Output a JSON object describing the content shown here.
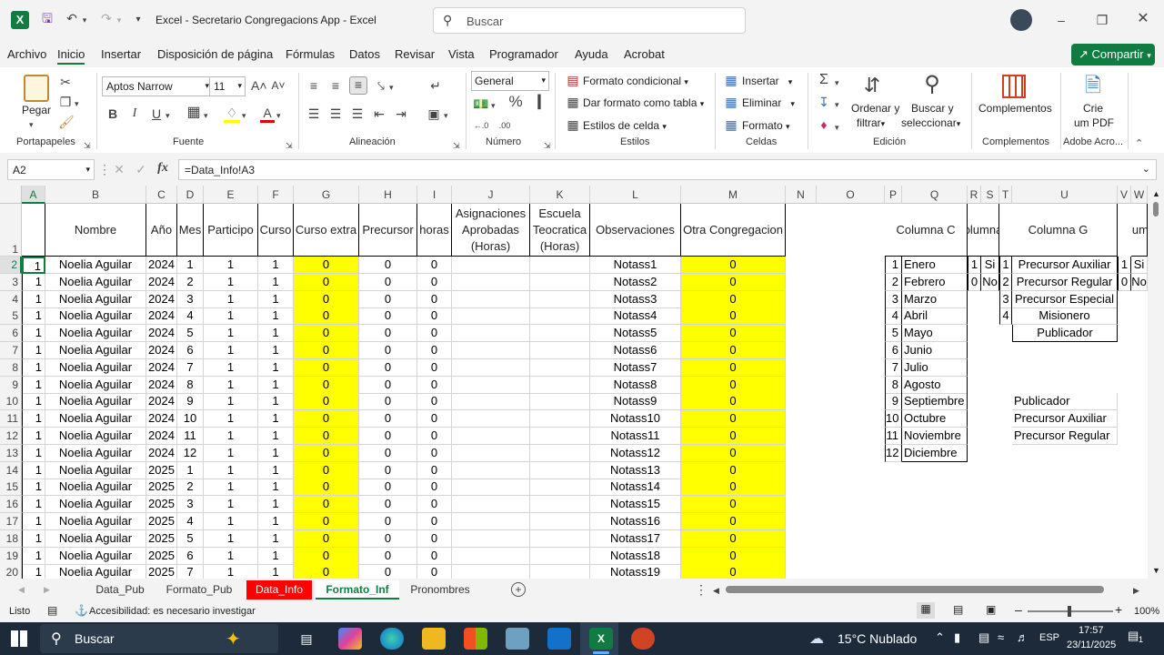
{
  "titlebar": {
    "file_title": "Excel - Secretario Congregacions App  -  Excel",
    "search_placeholder": "Buscar"
  },
  "menu": {
    "items": [
      "Archivo",
      "Inicio",
      "Insertar",
      "Disposición de página",
      "Fórmulas",
      "Datos",
      "Revisar",
      "Vista",
      "Programador",
      "Ayuda",
      "Acrobat"
    ],
    "share": "Compartir"
  },
  "ribbon": {
    "paste": "Pegar",
    "font_name": "Aptos Narrow",
    "font_size": "11",
    "number_format": "General",
    "cond_format": "Formato condicional",
    "table_format": "Dar formato como tabla",
    "cell_styles": "Estilos de celda",
    "insert": "Insertar",
    "delete": "Eliminar",
    "format": "Formato",
    "sort_filter_1": "Ordenar y",
    "sort_filter_2": "filtrar",
    "find_1": "Buscar y",
    "find_2": "seleccionar",
    "complements": "Complementos",
    "pdf_1": "Crie",
    "pdf_2": "um PDF",
    "groups": [
      "Portapapeles",
      "Fuente",
      "Alineación",
      "Número",
      "Estilos",
      "Celdas",
      "Edición",
      "Complementos",
      "Adobe Acro..."
    ]
  },
  "formula_bar": {
    "name_box": "A2",
    "formula": "=Data_Info!A3"
  },
  "columns": [
    "A",
    "B",
    "C",
    "D",
    "E",
    "F",
    "G",
    "H",
    "I",
    "J",
    "K",
    "L",
    "M",
    "N",
    "O",
    "P",
    "Q",
    "R",
    "S",
    "T",
    "U",
    "V",
    "W"
  ],
  "headers": {
    "B": "Nombre",
    "C": "Año",
    "D": "Mes",
    "E": "Participo",
    "F": "Curso",
    "G": "Curso extra",
    "H": "Precursor",
    "I": "horas",
    "J": "Asignaciones Aprobadas (Horas)",
    "K": "Escuela Teocratica (Horas)",
    "L": "Observaciones",
    "M": "Otra Congregacion",
    "Q": "Columna C",
    "R": "olumna",
    "U": "Columna G",
    "W": "olumn"
  },
  "rows": [
    {
      "n": "2",
      "a": "1",
      "name": "Noelia Aguilar",
      "year": "2024",
      "mes": "1",
      "part": "1",
      "curso": "1",
      "extra": "0",
      "prec": "0",
      "horas": "0",
      "obs": "Notass1",
      "otra": "0"
    },
    {
      "n": "3",
      "a": "1",
      "name": "Noelia Aguilar",
      "year": "2024",
      "mes": "2",
      "part": "1",
      "curso": "1",
      "extra": "0",
      "prec": "0",
      "horas": "0",
      "obs": "Notass2",
      "otra": "0"
    },
    {
      "n": "4",
      "a": "1",
      "name": "Noelia Aguilar",
      "year": "2024",
      "mes": "3",
      "part": "1",
      "curso": "1",
      "extra": "0",
      "prec": "0",
      "horas": "0",
      "obs": "Notass3",
      "otra": "0"
    },
    {
      "n": "5",
      "a": "1",
      "name": "Noelia Aguilar",
      "year": "2024",
      "mes": "4",
      "part": "1",
      "curso": "1",
      "extra": "0",
      "prec": "0",
      "horas": "0",
      "obs": "Notass4",
      "otra": "0"
    },
    {
      "n": "6",
      "a": "1",
      "name": "Noelia Aguilar",
      "year": "2024",
      "mes": "5",
      "part": "1",
      "curso": "1",
      "extra": "0",
      "prec": "0",
      "horas": "0",
      "obs": "Notass5",
      "otra": "0"
    },
    {
      "n": "7",
      "a": "1",
      "name": "Noelia Aguilar",
      "year": "2024",
      "mes": "6",
      "part": "1",
      "curso": "1",
      "extra": "0",
      "prec": "0",
      "horas": "0",
      "obs": "Notass6",
      "otra": "0"
    },
    {
      "n": "8",
      "a": "1",
      "name": "Noelia Aguilar",
      "year": "2024",
      "mes": "7",
      "part": "1",
      "curso": "1",
      "extra": "0",
      "prec": "0",
      "horas": "0",
      "obs": "Notass7",
      "otra": "0"
    },
    {
      "n": "9",
      "a": "1",
      "name": "Noelia Aguilar",
      "year": "2024",
      "mes": "8",
      "part": "1",
      "curso": "1",
      "extra": "0",
      "prec": "0",
      "horas": "0",
      "obs": "Notass8",
      "otra": "0"
    },
    {
      "n": "10",
      "a": "1",
      "name": "Noelia Aguilar",
      "year": "2024",
      "mes": "9",
      "part": "1",
      "curso": "1",
      "extra": "0",
      "prec": "0",
      "horas": "0",
      "obs": "Notass9",
      "otra": "0"
    },
    {
      "n": "11",
      "a": "1",
      "name": "Noelia Aguilar",
      "year": "2024",
      "mes": "10",
      "part": "1",
      "curso": "1",
      "extra": "0",
      "prec": "0",
      "horas": "0",
      "obs": "Notass10",
      "otra": "0"
    },
    {
      "n": "12",
      "a": "1",
      "name": "Noelia Aguilar",
      "year": "2024",
      "mes": "11",
      "part": "1",
      "curso": "1",
      "extra": "0",
      "prec": "0",
      "horas": "0",
      "obs": "Notass11",
      "otra": "0"
    },
    {
      "n": "13",
      "a": "1",
      "name": "Noelia Aguilar",
      "year": "2024",
      "mes": "12",
      "part": "1",
      "curso": "1",
      "extra": "0",
      "prec": "0",
      "horas": "0",
      "obs": "Notass12",
      "otra": "0"
    },
    {
      "n": "14",
      "a": "1",
      "name": "Noelia Aguilar",
      "year": "2025",
      "mes": "1",
      "part": "1",
      "curso": "1",
      "extra": "0",
      "prec": "0",
      "horas": "0",
      "obs": "Notass13",
      "otra": "0"
    },
    {
      "n": "15",
      "a": "1",
      "name": "Noelia Aguilar",
      "year": "2025",
      "mes": "2",
      "part": "1",
      "curso": "1",
      "extra": "0",
      "prec": "0",
      "horas": "0",
      "obs": "Notass14",
      "otra": "0"
    },
    {
      "n": "16",
      "a": "1",
      "name": "Noelia Aguilar",
      "year": "2025",
      "mes": "3",
      "part": "1",
      "curso": "1",
      "extra": "0",
      "prec": "0",
      "horas": "0",
      "obs": "Notass15",
      "otra": "0"
    },
    {
      "n": "17",
      "a": "1",
      "name": "Noelia Aguilar",
      "year": "2025",
      "mes": "4",
      "part": "1",
      "curso": "1",
      "extra": "0",
      "prec": "0",
      "horas": "0",
      "obs": "Notass16",
      "otra": "0"
    },
    {
      "n": "18",
      "a": "1",
      "name": "Noelia Aguilar",
      "year": "2025",
      "mes": "5",
      "part": "1",
      "curso": "1",
      "extra": "0",
      "prec": "0",
      "horas": "0",
      "obs": "Notass17",
      "otra": "0"
    },
    {
      "n": "19",
      "a": "1",
      "name": "Noelia Aguilar",
      "year": "2025",
      "mes": "6",
      "part": "1",
      "curso": "1",
      "extra": "0",
      "prec": "0",
      "horas": "0",
      "obs": "Notass18",
      "otra": "0"
    },
    {
      "n": "20",
      "a": "1",
      "name": "Noelia Aguilar",
      "year": "2025",
      "mes": "7",
      "part": "1",
      "curso": "1",
      "extra": "0",
      "prec": "0",
      "horas": "0",
      "obs": "Notass19",
      "otra": "0"
    }
  ],
  "months": [
    [
      "1",
      "Enero"
    ],
    [
      "2",
      "Febrero"
    ],
    [
      "3",
      "Marzo"
    ],
    [
      "4",
      "Abril"
    ],
    [
      "5",
      "Mayo"
    ],
    [
      "6",
      "Junio"
    ],
    [
      "7",
      "Julio"
    ],
    [
      "8",
      "Agosto"
    ],
    [
      "9",
      "Septiembre"
    ],
    [
      "10",
      "Octubre"
    ],
    [
      "11",
      "Noviembre"
    ],
    [
      "12",
      "Diciembre"
    ]
  ],
  "yesno": [
    [
      "1",
      "Si"
    ],
    [
      "0",
      "No"
    ]
  ],
  "precursor_types": [
    [
      "1",
      "Precursor Auxiliar"
    ],
    [
      "2",
      "Precursor Regular"
    ],
    [
      "3",
      "Precursor Especial"
    ],
    [
      "4",
      "Misionero"
    ],
    [
      "",
      "Publicador"
    ]
  ],
  "yesno_w": [
    [
      "1",
      "Si"
    ],
    [
      "0",
      "No"
    ]
  ],
  "u_list": [
    "Publicador",
    "Precursor Auxiliar",
    "Precursor Regular"
  ],
  "sheet_tabs": [
    "Data_Pub",
    "Formato_Pub",
    "Data_Info",
    "Formato_Inf",
    "Pronombres"
  ],
  "status": {
    "ready": "Listo",
    "accessibility": "Accesibilidad: es necesario investigar",
    "zoom": "100%"
  },
  "taskbar": {
    "search": "Buscar",
    "weather": "15°C  Nublado",
    "lang": "ESP",
    "time": "17:57",
    "date": "23/11/2025",
    "notif": "1"
  },
  "colors": {
    "excel_green": "#107c41",
    "yellow": "#ffff00",
    "red_tab": "#ff0000"
  }
}
